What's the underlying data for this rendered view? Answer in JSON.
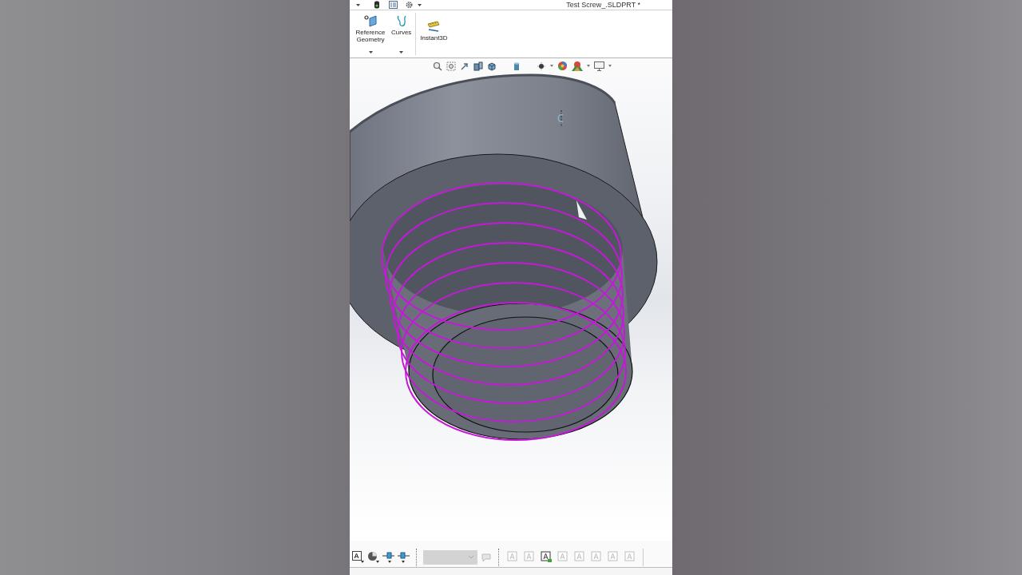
{
  "window": {
    "title": "Test Screw_.SLDPRT *"
  },
  "ribbon": {
    "groups": [
      {
        "items": [
          {
            "kind": "reference-geometry",
            "label": "Reference Geometry",
            "dropdown": true
          },
          {
            "kind": "curves",
            "label": "Curves",
            "dropdown": true
          }
        ]
      },
      {
        "items": [
          {
            "kind": "instant3d",
            "label": "Instant3D",
            "dropdown": false
          }
        ]
      }
    ]
  },
  "bottom_toolbar": {
    "style_field": {
      "disabled": true
    },
    "style_button": {
      "disabled": true
    },
    "annotation_tools": [
      {
        "disabled": true
      },
      {
        "disabled": true
      },
      {
        "disabled": false
      },
      {
        "disabled": true
      },
      {
        "disabled": true
      },
      {
        "disabled": true
      },
      {
        "disabled": true
      },
      {
        "disabled": true
      }
    ]
  }
}
